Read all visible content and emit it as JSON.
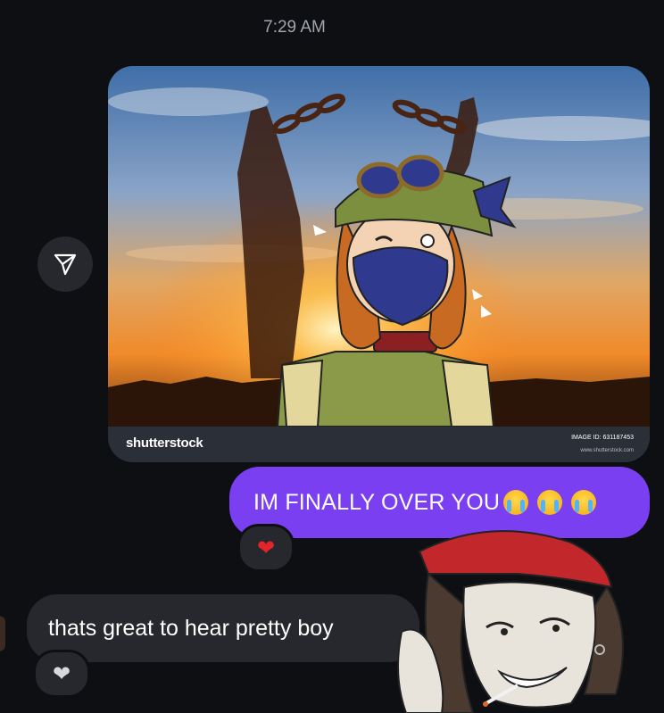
{
  "header": {
    "timestamp": "7:29 AM"
  },
  "share": {
    "icon": "send-icon"
  },
  "photo": {
    "watermark_logo": "shutterstock",
    "image_id_text": "IMAGE ID: 631187453",
    "url_text": "www.shutterstock.com"
  },
  "messages": {
    "outgoing": {
      "text": "IM FINALLY OVER YOU",
      "emojis": [
        "loudly-crying-face",
        "loudly-crying-face",
        "loudly-crying-face"
      ]
    },
    "outgoing_reaction": "❤",
    "incoming": {
      "text": "thats great to hear pretty boy"
    },
    "incoming_reaction": "❤"
  },
  "colors": {
    "background": "#0d0f13",
    "outgoing_bubble": "#7b3ff2",
    "incoming_bubble": "#26282d",
    "red_heart": "#e3242b",
    "white_heart": "#d8d9dc"
  }
}
